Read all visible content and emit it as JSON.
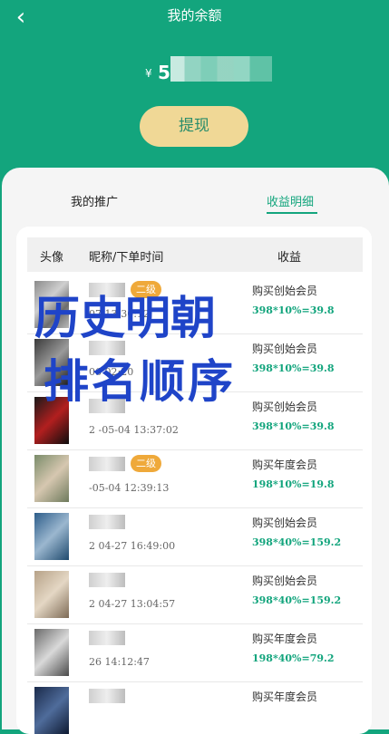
{
  "header": {
    "title": "我的余额",
    "back_icon": "chevron-left-icon",
    "currency": "¥",
    "balance": "5"
  },
  "withdraw_label": "提现",
  "tabs": [
    {
      "label": "我的推广",
      "active": false
    },
    {
      "label": "收益明细",
      "active": true
    }
  ],
  "table": {
    "headers": [
      "头像",
      "昵称/下单时间",
      "收益"
    ],
    "rows": [
      {
        "level": "二级",
        "date": "07 13:30:12",
        "product": "购买创始会员",
        "calc": "398*10%=39.8"
      },
      {
        "level": "",
        "date": "06 02:20",
        "product": "购买创始会员",
        "calc": "398*10%=39.8"
      },
      {
        "level": "",
        "date": "2 -05-04 13:37:02",
        "product": "购买创始会员",
        "calc": "398*10%=39.8"
      },
      {
        "level": "二级",
        "date": "-05-04 12:39:13",
        "product": "购买年度会员",
        "calc": "198*10%=19.8"
      },
      {
        "level": "",
        "date": "2 04-27 16:49:00",
        "product": "购买创始会员",
        "calc": "398*40%=159.2"
      },
      {
        "level": "",
        "date": "2 04-27 13:04:57",
        "product": "购买创始会员",
        "calc": "398*40%=159.2"
      },
      {
        "level": "",
        "date": "26 14:12:47",
        "product": "购买年度会员",
        "calc": "198*40%=79.2"
      },
      {
        "level": "",
        "date": "",
        "product": "购买年度会员",
        "calc": ""
      }
    ]
  },
  "watermark": {
    "line1": "历史明朝",
    "line2": "排名顺序"
  }
}
